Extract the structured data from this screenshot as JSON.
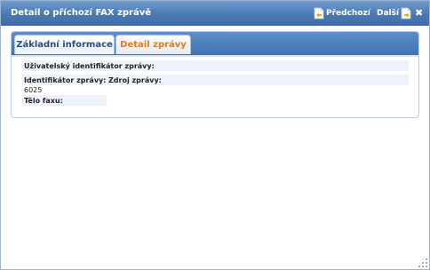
{
  "window": {
    "title": "Detail o příchozí FAX zprávě",
    "prev_label": "Předchozí",
    "next_label": "Další",
    "close_glyph": "✖"
  },
  "tabs": [
    {
      "label": "Základní informace",
      "active": false
    },
    {
      "label": "Detail zprávy",
      "active": true
    }
  ],
  "fields": {
    "user_id_label": "Uživatelský identifikátor zprávy:",
    "msg_id_label": "Identifikátor zprávy:",
    "source_label": "Zdroj zprávy:",
    "msg_id_value": "6025",
    "fax_body_label": "Tělo faxu:"
  },
  "colors": {
    "titlebar": "#4a79b2",
    "active_tab_text": "#e07b22",
    "inactive_tab_text": "#2f4d7a"
  }
}
